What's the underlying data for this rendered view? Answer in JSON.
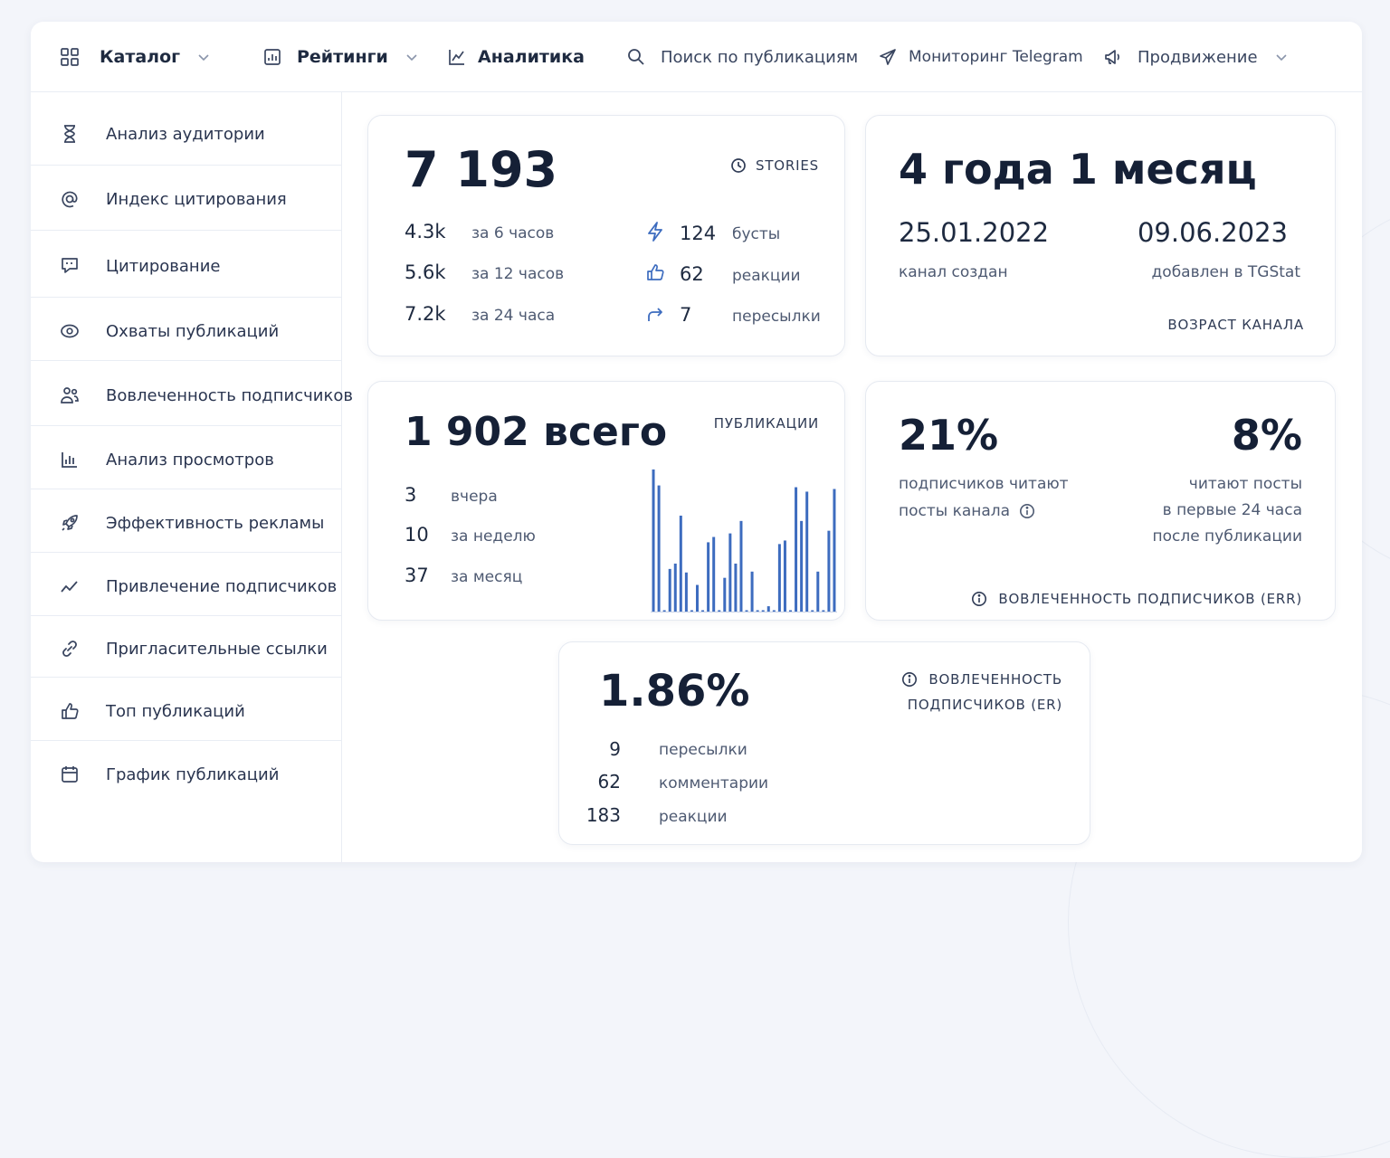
{
  "nav": {
    "catalog": "Каталог",
    "ratings": "Рейтинги",
    "analytics": "Аналитика",
    "search": "Поиск по публикациям",
    "telegram": "Мониторинг Telegram",
    "promotion": "Продвижение"
  },
  "sidebar": {
    "items": [
      {
        "label": "Анализ аудитории",
        "icon": "hourglass-icon"
      },
      {
        "label": "Индекс цитирования",
        "icon": "at-icon"
      },
      {
        "label": "Цитирование",
        "icon": "quote-bubble-icon"
      },
      {
        "label": "Охваты публикаций",
        "icon": "eye-icon"
      },
      {
        "label": "Вовлеченность подписчиков",
        "icon": "users-icon"
      },
      {
        "label": "Анализ просмотров",
        "icon": "bar-chart-icon"
      },
      {
        "label": "Эффективность рекламы",
        "icon": "rocket-icon"
      },
      {
        "label": "Привлечение подписчиков",
        "icon": "trend-icon"
      },
      {
        "label": "Пригласительные ссылки",
        "icon": "link-icon"
      },
      {
        "label": "Топ публикаций",
        "icon": "thumbs-up-icon"
      },
      {
        "label": "График публикаций",
        "icon": "calendar-icon"
      }
    ]
  },
  "stories": {
    "total": "7 193",
    "tag": "STORIES",
    "rows": [
      {
        "value": "4.3k",
        "label": "за 6 часов"
      },
      {
        "value": "5.6k",
        "label": "за 12 часов"
      },
      {
        "value": "7.2k",
        "label": "за 24 часа"
      }
    ],
    "stats": [
      {
        "value": "124",
        "label": "бусты",
        "icon": "lightning-icon"
      },
      {
        "value": "62",
        "label": "реакции",
        "icon": "thumbs-up-icon"
      },
      {
        "value": "7",
        "label": "пересылки",
        "icon": "forward-icon"
      }
    ]
  },
  "age": {
    "title": "4 года 1 месяц",
    "created_date": "25.01.2022",
    "created_label": "канал создан",
    "added_date": "09.06.2023",
    "added_label": "добавлен в TGStat",
    "tag": "ВОЗРАСТ КАНАЛА"
  },
  "posts": {
    "total": "1 902 всего",
    "tag": "ПУБЛИКАЦИИ",
    "rows": [
      {
        "value": "3",
        "label": "вчера"
      },
      {
        "value": "10",
        "label": "за неделю"
      },
      {
        "value": "37",
        "label": "за месяц"
      }
    ],
    "bar_color": "#3d6cbf"
  },
  "err": {
    "left_value": "21%",
    "left_line1": "подписчиков читают",
    "left_line2": "посты канала",
    "right_value": "8%",
    "right_line1": "читают посты",
    "right_line2": "в первые 24 часа",
    "right_line3": "после публикации",
    "tag": "ВОВЛЕЧЕННОСТЬ ПОДПИСЧИКОВ (ERR)"
  },
  "er": {
    "value": "1.86%",
    "tag_line1": "ВОВЛЕЧЕННОСТЬ",
    "tag_line2": "ПОДПИСЧИКОВ (ER)",
    "rows": [
      {
        "value": "9",
        "label": "пересылки"
      },
      {
        "value": "62",
        "label": "комментарии"
      },
      {
        "value": "183",
        "label": "реакции"
      }
    ]
  },
  "chart_data": {
    "type": "bar",
    "values": [
      160,
      142,
      1,
      48,
      54,
      108,
      44,
      1,
      30,
      1,
      78,
      84,
      1,
      38,
      88,
      54,
      102,
      1,
      45,
      1,
      1,
      6,
      1,
      76,
      80,
      1,
      140,
      102,
      135,
      1,
      45,
      1,
      91,
      138
    ],
    "ylim": [
      0,
      165
    ],
    "color": "#3d6cbf"
  }
}
